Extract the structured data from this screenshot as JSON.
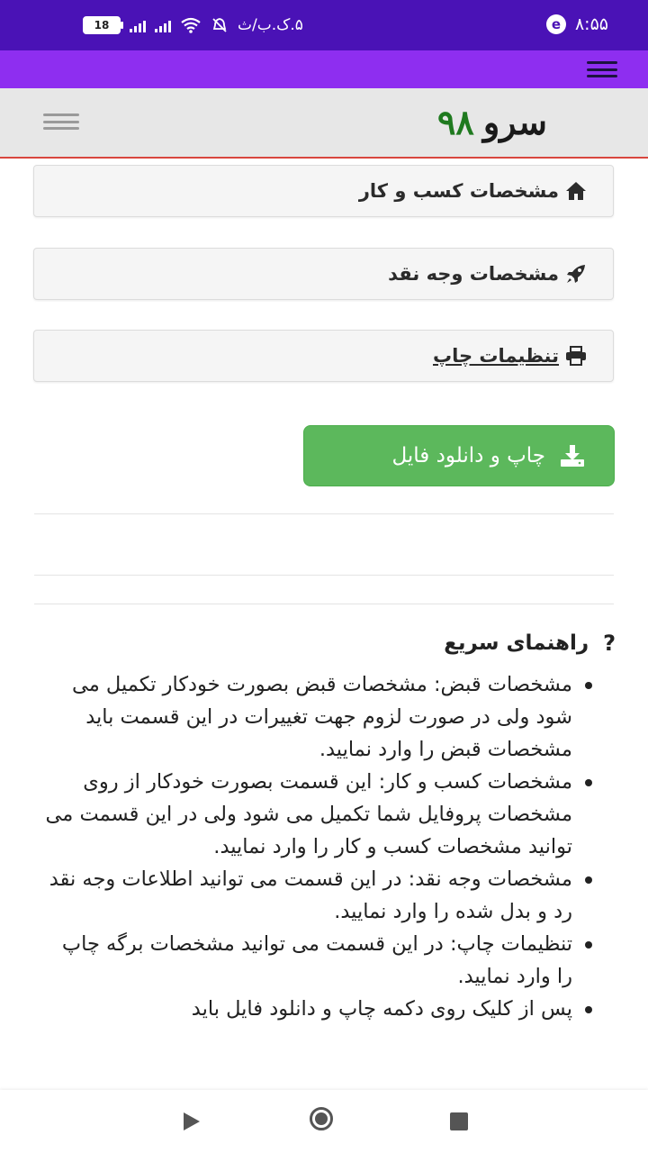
{
  "status_bar": {
    "time": "۸:۵۵",
    "date_text": "۵.ک.ب/ث",
    "battery": "18",
    "colors": {
      "background": "#4a12b6"
    }
  },
  "app_bar": {
    "menu_icon": "hamburger-icon",
    "color": "#8e2ef0"
  },
  "site_header": {
    "logo_text": "سرو",
    "logo_number": "۹۸",
    "menu_icon": "hamburger-icon"
  },
  "panels": [
    {
      "label": "مشخصات کسب و کار",
      "icon": "home-icon"
    },
    {
      "label": "مشخصات وجه نقد",
      "icon": "rocket-icon"
    },
    {
      "label": "تنظیمات چاپ",
      "icon": "printer-icon"
    }
  ],
  "print_button": {
    "label": "چاپ و دانلود فایل",
    "icon": "download-icon",
    "color": "#5cb85c"
  },
  "guide": {
    "title": "راهنمای سریع",
    "icon": "question-icon",
    "items": [
      "مشخصات قبض: مشخصات قبض بصورت خودکار تکمیل می شود ولی در صورت لزوم جهت تغییرات در این قسمت باید مشخصات قبض را وارد نمایید.",
      "مشخصات کسب و کار: این قسمت بصورت خودکار از روی مشخصات پروفایل شما تکمیل می شود ولی در این قسمت می توانید مشخصات کسب و کار را وارد نمایید.",
      "مشخصات وجه نقد: در این قسمت می توانید اطلاعات وجه نقد رد و بدل شده را وارد نمایید.",
      "تنظیمات چاپ: در این قسمت می توانید مشخصات برگه چاپ را وارد نمایید.",
      "پس از کلیک روی دکمه چاپ و دانلود فایل باید"
    ]
  },
  "nav_bar": {
    "back": "back-icon",
    "home": "home-circle-icon",
    "recents": "recents-icon"
  }
}
